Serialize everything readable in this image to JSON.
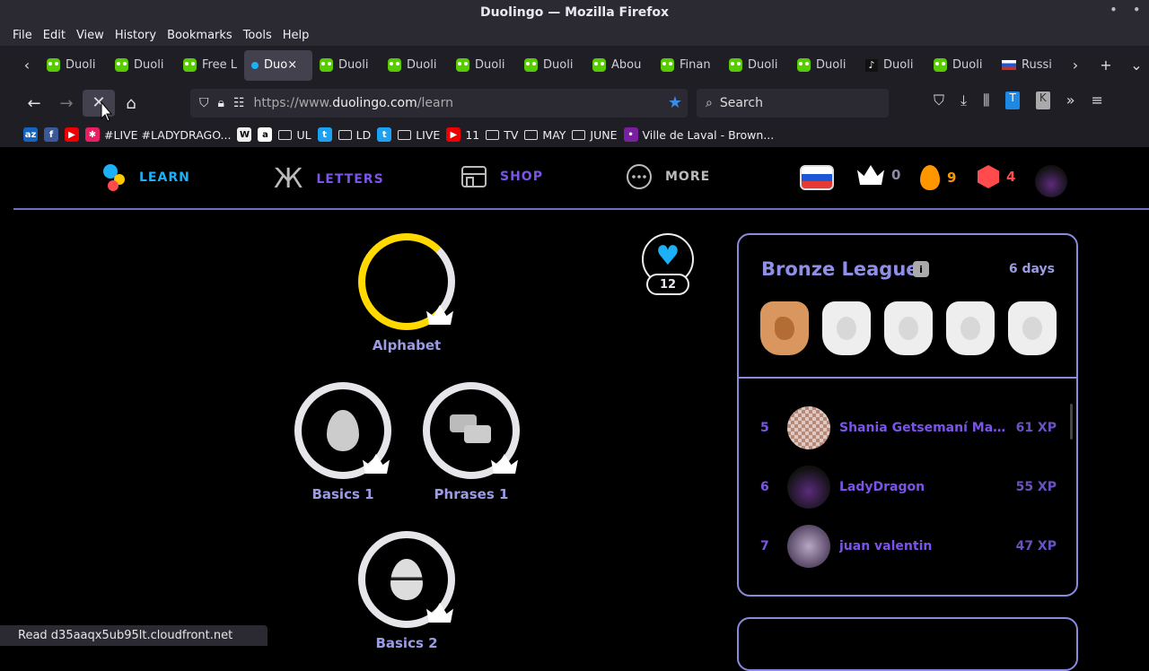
{
  "window": {
    "title": "Duolingo — Mozilla Firefox"
  },
  "menu": [
    "File",
    "Edit",
    "View",
    "History",
    "Bookmarks",
    "Tools",
    "Help"
  ],
  "tabs": [
    {
      "label": "Duoli",
      "icon": "owl"
    },
    {
      "label": "Duoli",
      "icon": "owl"
    },
    {
      "label": "Free L",
      "icon": "owl"
    },
    {
      "label": "Duo×",
      "icon": "dot",
      "active": true
    },
    {
      "label": "Duoli",
      "icon": "owl"
    },
    {
      "label": "Duoli",
      "icon": "owl"
    },
    {
      "label": "Duoli",
      "icon": "owl"
    },
    {
      "label": "Duoli",
      "icon": "owl"
    },
    {
      "label": "Abou",
      "icon": "owl"
    },
    {
      "label": "Finan",
      "icon": "owl"
    },
    {
      "label": "Duoli",
      "icon": "owl"
    },
    {
      "label": "Duoli",
      "icon": "owl"
    },
    {
      "label": "Duoli",
      "icon": "tiktok"
    },
    {
      "label": "Duoli",
      "icon": "owl"
    },
    {
      "label": "Russi",
      "icon": "flag"
    }
  ],
  "url": {
    "prefix": "https://www.",
    "domain": "duolingo.com",
    "path": "/learn"
  },
  "search": {
    "placeholder": "Search"
  },
  "bookmarks": [
    {
      "label": "",
      "icon": "az",
      "color": "#1565c0",
      "text": "az"
    },
    {
      "label": "",
      "icon": "f",
      "color": "#3b5998",
      "text": "f"
    },
    {
      "label": "",
      "icon": "yt",
      "color": "#e00",
      "text": "▶"
    },
    {
      "label": "#LIVE #LADYDRAGO...",
      "icon": "app",
      "color": "#e91e63",
      "text": "✱"
    },
    {
      "label": "",
      "icon": "w",
      "color": "#eee",
      "text": "W"
    },
    {
      "label": "",
      "icon": "amazon",
      "color": "#fff",
      "text": "a"
    },
    {
      "label": "UL",
      "icon": "folder"
    },
    {
      "label": "",
      "icon": "twitter",
      "color": "#1da1f2",
      "text": "t"
    },
    {
      "label": "LD",
      "icon": "folder"
    },
    {
      "label": "",
      "icon": "twitter",
      "color": "#1da1f2",
      "text": "t"
    },
    {
      "label": "LIVE",
      "icon": "folder"
    },
    {
      "label": "11",
      "icon": "yt",
      "color": "#e00",
      "text": "▶"
    },
    {
      "label": "TV",
      "icon": "folder"
    },
    {
      "label": "MAY",
      "icon": "folder"
    },
    {
      "label": "JUNE",
      "icon": "folder"
    },
    {
      "label": "Ville de Laval - Brown...",
      "icon": "dots",
      "color": "#7b1fa2",
      "text": "•"
    }
  ],
  "duo_nav": {
    "learn": "LEARN",
    "letters": "LETTERS",
    "shop": "SHOP",
    "more": "MORE"
  },
  "stats": {
    "crowns": "0",
    "streak": "9",
    "gems": "4"
  },
  "skills": [
    {
      "name": "Alphabet"
    },
    {
      "name": "Basics 1"
    },
    {
      "name": "Phrases 1"
    },
    {
      "name": "Basics 2"
    }
  ],
  "hearts": {
    "count": "12"
  },
  "league": {
    "title": "Bronze League",
    "info_label": "i",
    "days": "6 days",
    "rows": [
      {
        "rank": "5",
        "name": "Shania Getsemaní Mart...",
        "xp": "61 XP"
      },
      {
        "rank": "6",
        "name": "LadyDragon",
        "xp": "55 XP"
      },
      {
        "rank": "7",
        "name": "juan valentin",
        "xp": "47 XP"
      }
    ]
  },
  "status": "Read d35aaqx5ub95lt.cloudfront.net"
}
